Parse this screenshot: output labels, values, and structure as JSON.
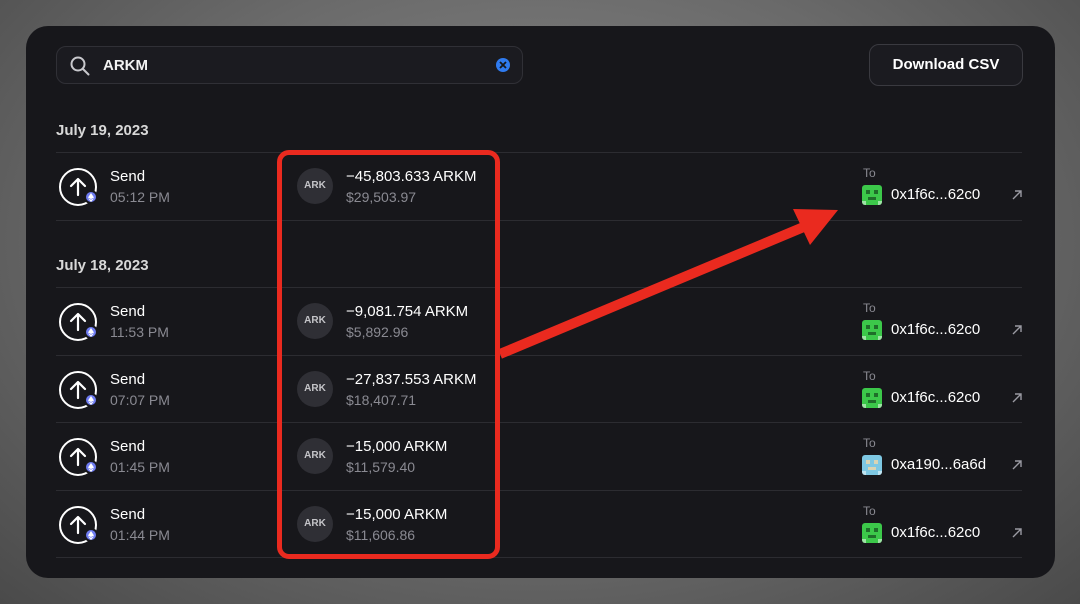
{
  "search": {
    "value": "ARKM",
    "icon": "search-icon",
    "clear_icon": "clear-icon"
  },
  "toolbar": {
    "download_label": "Download CSV"
  },
  "groups": [
    {
      "date": "July 19, 2023"
    },
    {
      "date": "July 18, 2023"
    }
  ],
  "transactions": [
    {
      "type": "Send",
      "time": "05:12 PM",
      "token": "ARK",
      "amount": "−45,803.633 ARKM",
      "usd": "$29,503.97",
      "to_label": "To",
      "to_address": "0x1f6c...62c0",
      "avatar": "green"
    },
    {
      "type": "Send",
      "time": "11:53 PM",
      "token": "ARK",
      "amount": "−9,081.754 ARKM",
      "usd": "$5,892.96",
      "to_label": "To",
      "to_address": "0x1f6c...62c0",
      "avatar": "green"
    },
    {
      "type": "Send",
      "time": "07:07 PM",
      "token": "ARK",
      "amount": "−27,837.553 ARKM",
      "usd": "$18,407.71",
      "to_label": "To",
      "to_address": "0x1f6c...62c0",
      "avatar": "green"
    },
    {
      "type": "Send",
      "time": "01:45 PM",
      "token": "ARK",
      "amount": "−15,000 ARKM",
      "usd": "$11,579.40",
      "to_label": "To",
      "to_address": "0xa190...6a6d",
      "avatar": "blue"
    },
    {
      "type": "Send",
      "time": "01:44 PM",
      "token": "ARK",
      "amount": "−15,000 ARKM",
      "usd": "$11,606.86",
      "to_label": "To",
      "to_address": "0x1f6c...62c0",
      "avatar": "green"
    }
  ],
  "colors": {
    "panel": "#17171b",
    "annotation": "#ea2a1f",
    "eth_badge": "#6f7cf2",
    "clear_button": "#2f7bf0",
    "avatar_green": "#3cc84a",
    "avatar_blue": "#7ec8e3"
  }
}
